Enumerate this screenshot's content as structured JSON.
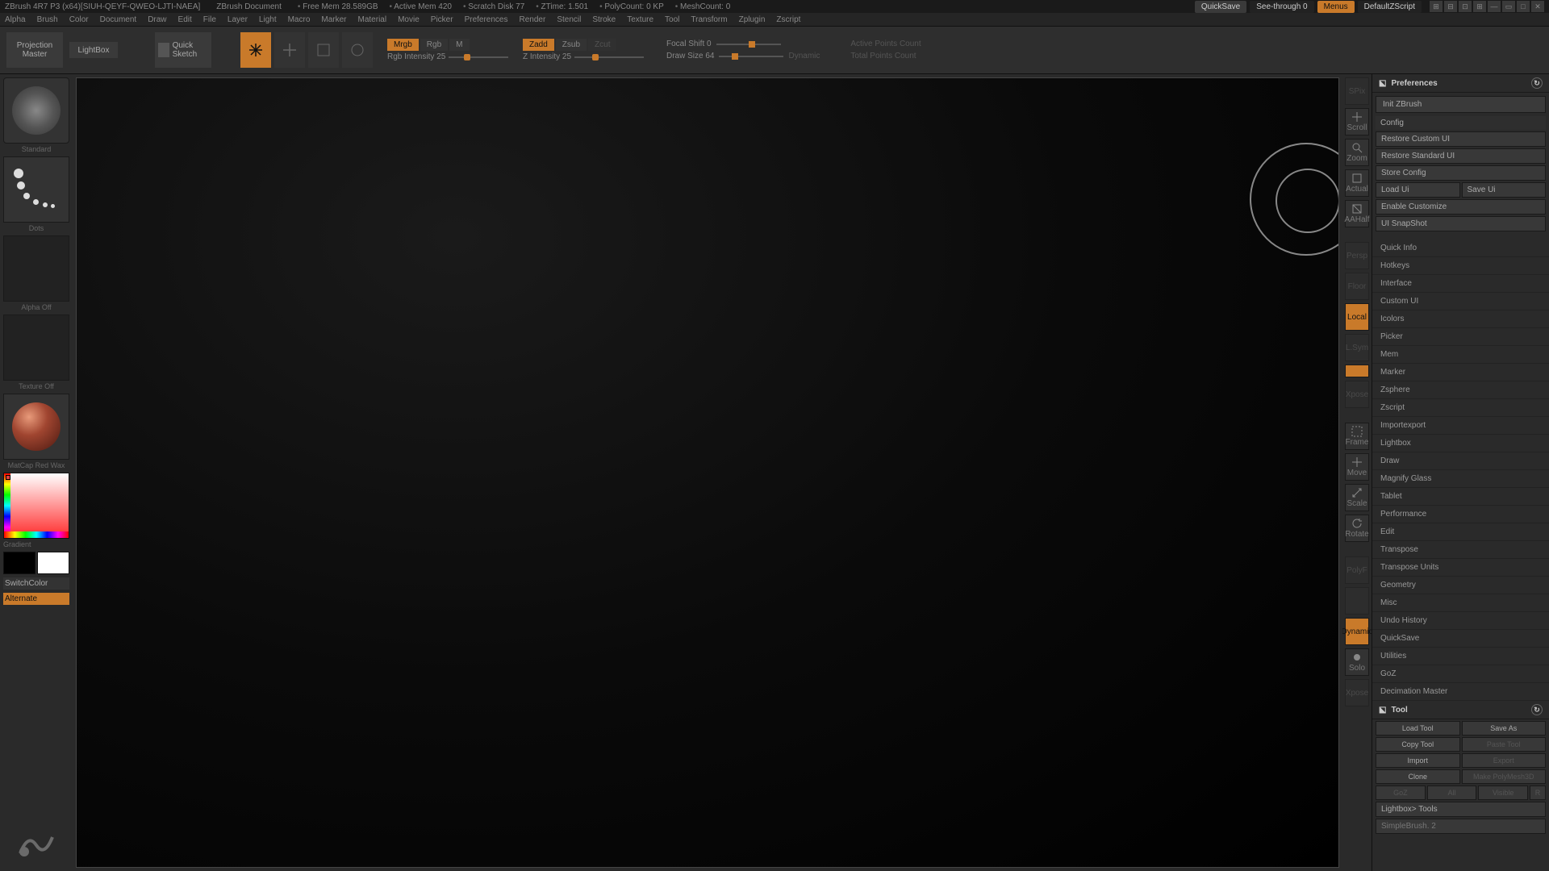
{
  "title": {
    "app": "ZBrush 4R7 P3 (x64)[SIUH-QEYF-QWEO-LJTI-NAEA]",
    "doc": "ZBrush Document"
  },
  "stats": {
    "freemem": "Free Mem 28.589GB",
    "activemem": "Active Mem 420",
    "scratch": "Scratch Disk 77",
    "ztime": "ZTime: 1.501",
    "polycount": "PolyCount: 0 KP",
    "meshcount": "MeshCount: 0"
  },
  "topbtns": {
    "quicksave": "QuickSave",
    "seethrough": "See-through  0",
    "menus": "Menus",
    "script": "DefaultZScript"
  },
  "menu": [
    "Alpha",
    "Brush",
    "Color",
    "Document",
    "Draw",
    "Edit",
    "File",
    "Layer",
    "Light",
    "Macro",
    "Marker",
    "Material",
    "Movie",
    "Picker",
    "Preferences",
    "Render",
    "Stencil",
    "Stroke",
    "Texture",
    "Tool",
    "Transform",
    "Zplugin",
    "Zscript"
  ],
  "shelf": {
    "projection": "Projection Master",
    "lightbox": "LightBox",
    "quicksketch": "Quick Sketch",
    "channels": {
      "mrgb": "Mrgb",
      "rgb": "Rgb",
      "m": "M",
      "zadd": "Zadd",
      "zsub": "Zsub",
      "zcut": "Zcut"
    },
    "rgbint": "Rgb Intensity 25",
    "zint": "Z Intensity 25",
    "focal": "Focal Shift 0",
    "drawsize": "Draw Size 64",
    "dynamic": "Dynamic",
    "apc": "Active Points Count",
    "tpc": "Total Points Count"
  },
  "left": {
    "brush": "Standard",
    "stroke": "Dots",
    "alpha": "Alpha Off",
    "texture": "Texture Off",
    "material": "MatCap Red Wax",
    "gradient": "Gradient",
    "switchcolor": "SwitchColor",
    "alternate": "Alternate"
  },
  "nav": {
    "spix": "SPix",
    "scroll": "Scroll",
    "zoom": "Zoom",
    "actual": "Actual",
    "aahalf": "AAHalf",
    "persp": "Persp",
    "floor": "Floor",
    "local": "Local",
    "lsym": "L.Sym",
    "xpose": "Xpose",
    "frame": "Frame",
    "move": "Move",
    "scale": "Scale",
    "rotate": "Rotate",
    "pf": "PolyF",
    "dynamic": "Dynamic",
    "solo": "Solo",
    "xpose2": "Xpose"
  },
  "prefs": {
    "title": "Preferences",
    "init": "Init ZBrush",
    "config_head": "Config",
    "restore_custom": "Restore Custom UI",
    "restore_standard": "Restore Standard UI",
    "store_config": "Store Config",
    "load_ui": "Load Ui",
    "save_ui": "Save Ui",
    "enable_customize": "Enable Customize",
    "ui_snapshot": "UI SnapShot",
    "cats": [
      "Quick Info",
      "Hotkeys",
      "Interface",
      "Custom UI",
      "Icolors",
      "Picker",
      "Mem",
      "Marker",
      "Zsphere",
      "Zscript",
      "Importexport",
      "Lightbox",
      "Draw",
      "Magnify Glass",
      "Tablet",
      "Performance",
      "Edit",
      "Transpose",
      "Transpose Units",
      "Geometry",
      "Misc",
      "Undo History",
      "QuickSave",
      "Utilities",
      "GoZ",
      "Decimation Master"
    ]
  },
  "tool": {
    "title": "Tool",
    "load": "Load Tool",
    "saveas": "Save As",
    "copy": "Copy Tool",
    "paste": "Paste Tool",
    "import": "Import",
    "export": "Export",
    "clone": "Clone",
    "makepoly": "Make PolyMesh3D",
    "goz": "GoZ",
    "all": "All",
    "visible": "Visible",
    "r": "R",
    "lbtools": "Lightbox> Tools",
    "simple": "SimpleBrush. 2"
  }
}
